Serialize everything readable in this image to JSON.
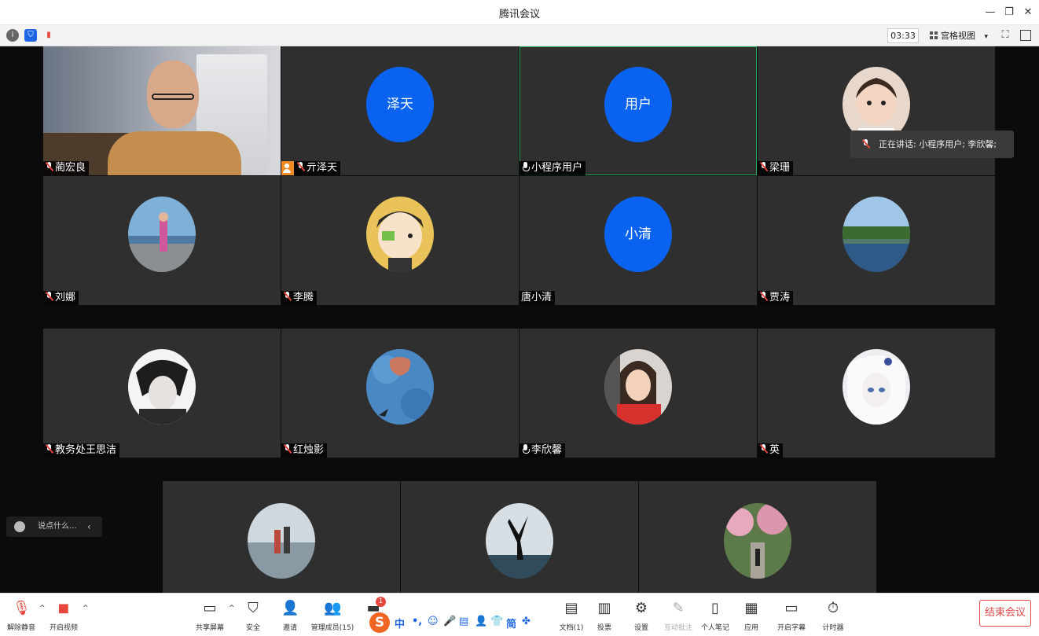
{
  "window": {
    "title": "腾讯会议",
    "controls": {
      "minimize": "—",
      "restore": "❐",
      "close": "✕"
    }
  },
  "topbar": {
    "timer": "03:33",
    "view_mode": "宫格视图",
    "view_caret": "▾"
  },
  "speaking": {
    "text": "正在讲话: 小程序用户; 李欣馨;"
  },
  "participants": [
    {
      "name": "蔺宏良",
      "mic": "muted",
      "kind": "camera"
    },
    {
      "name": "亓泽天",
      "mic": "muted",
      "kind": "text-avatar",
      "avatar_text": "泽天",
      "host": true
    },
    {
      "name": "小程序用户",
      "mic": "on",
      "kind": "text-avatar",
      "avatar_text": "用户",
      "active": true
    },
    {
      "name": "梁珊",
      "mic": "muted",
      "kind": "photo"
    },
    {
      "name": "刘娜",
      "mic": "muted",
      "kind": "photo"
    },
    {
      "name": "李腾",
      "mic": "muted",
      "kind": "photo"
    },
    {
      "name": "唐小清",
      "mic": "none",
      "kind": "text-avatar",
      "avatar_text": "小清"
    },
    {
      "name": "贾涛",
      "mic": "muted",
      "kind": "photo"
    },
    {
      "name": "教务处王思洁",
      "mic": "muted",
      "kind": "photo"
    },
    {
      "name": "红烛影",
      "mic": "muted",
      "kind": "photo"
    },
    {
      "name": "李欣馨",
      "mic": "on",
      "kind": "photo"
    },
    {
      "name": "英",
      "mic": "muted",
      "kind": "photo"
    }
  ],
  "chat": {
    "placeholder": "说点什么...",
    "collapse": "‹"
  },
  "controls": {
    "unmute": "解除静音",
    "start_video": "开启视频",
    "share_screen": "共享屏幕",
    "security": "安全",
    "invite": "邀请",
    "manage_members": "管理成员(15)",
    "chat_badge": "1",
    "documents": "文档(1)",
    "vote": "投票",
    "settings": "设置",
    "interactive_annotation": "互动批注",
    "personal_notes": "个人笔记",
    "apps": "应用",
    "captions": "开启字幕",
    "timer": "计时器",
    "end_meeting": "结束会议",
    "caret": "^"
  },
  "ime": {
    "logo": "S",
    "items": [
      "中",
      "•,",
      "☺",
      "🎤",
      "▤",
      "👤",
      "👕",
      "简",
      "✤"
    ]
  },
  "colors": {
    "accent_blue": "#0a63f0",
    "tile_bg": "#2f2f2f",
    "end_red": "#e0494a",
    "host_orange": "#f08a24",
    "active_green": "#2aa85a"
  }
}
